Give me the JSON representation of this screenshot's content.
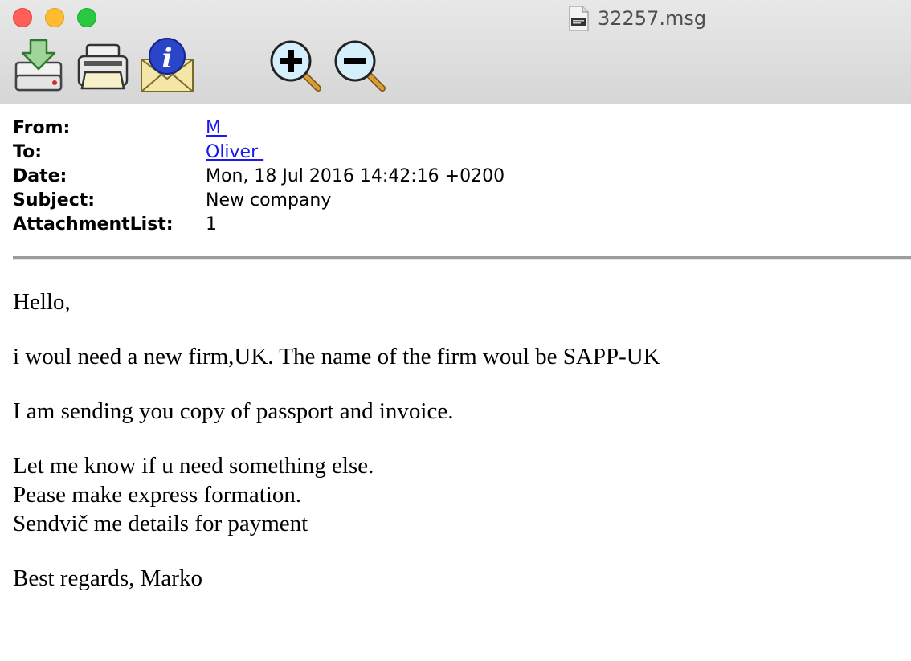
{
  "window": {
    "title": "32257.msg",
    "traffic_lights": {
      "close": "#ff5f57",
      "minimize": "#febc2e",
      "maximize": "#28c840"
    }
  },
  "toolbar": {
    "buttons": [
      {
        "name": "save-attachments",
        "icon": "save-download-icon"
      },
      {
        "name": "print",
        "icon": "printer-icon"
      },
      {
        "name": "message-info",
        "icon": "info-envelope-icon"
      },
      {
        "name": "zoom-in",
        "icon": "zoom-in-icon"
      },
      {
        "name": "zoom-out",
        "icon": "zoom-out-icon"
      }
    ]
  },
  "headers": {
    "from": {
      "label": "From:",
      "value": "M "
    },
    "to": {
      "label": "To:",
      "value": "Oliver "
    },
    "date": {
      "label": "Date:",
      "value": "Mon, 18 Jul 2016 14:42:16 +0200"
    },
    "subject": {
      "label": "Subject:",
      "value": "New company"
    },
    "attachments": {
      "label": "AttachmentList:",
      "value": "1"
    }
  },
  "body": {
    "greeting": "Hello,",
    "line1": "i woul need a new firm,UK. The name of the firm woul be SAPP-UK",
    "line2": "I am sending you copy of passport and invoice.",
    "line3": "Let me know if u need something else.",
    "line4": "Pease make express formation.",
    "line5": "Sendvič me details for payment",
    "signoff": "Best regards, Marko"
  },
  "colors": {
    "link": "#1a1aee",
    "titlebar": "#dcdcdc",
    "divider": "#9c9c9c"
  }
}
